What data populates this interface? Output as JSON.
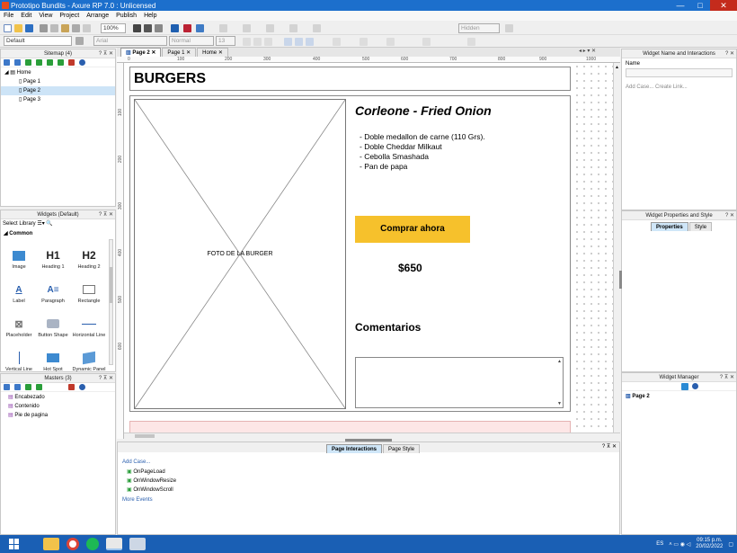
{
  "titlebar": {
    "title": "Prototipo Bundits - Axure RP 7.0 : Unlicensed",
    "min": "—",
    "max": "□",
    "close": "✕"
  },
  "menu": [
    "File",
    "Edit",
    "View",
    "Project",
    "Arrange",
    "Publish",
    "Help"
  ],
  "toolbar": {
    "zoom": "100%",
    "style": "Default",
    "font": "Arial",
    "weight": "Normal",
    "size": "13",
    "hidden_label": "Hidden"
  },
  "sitemap": {
    "title": "Sitemap (4)",
    "items": [
      "Home",
      "Page 1",
      "Page 2",
      "Page 3"
    ]
  },
  "widgets": {
    "title": "Widgets (Default)",
    "select_label": "Select Library",
    "section": "Common",
    "items": [
      {
        "label": "Image",
        "icon": "image-icon"
      },
      {
        "label": "Heading 1",
        "icon": "H1"
      },
      {
        "label": "Heading 2",
        "icon": "H2"
      },
      {
        "label": "Label",
        "icon": "A_"
      },
      {
        "label": "Paragraph",
        "icon": "A≡"
      },
      {
        "label": "Rectangle",
        "icon": "rect-icon"
      },
      {
        "label": "Placeholder",
        "icon": "placeholder-icon"
      },
      {
        "label": "Button Shape",
        "icon": "button-shape-icon"
      },
      {
        "label": "Horizontal Line",
        "icon": "hline-icon"
      },
      {
        "label": "Vertical Line",
        "icon": "vline-icon"
      },
      {
        "label": "Hot Spot",
        "icon": "hotspot-icon"
      },
      {
        "label": "Dynamic Panel",
        "icon": "dynamic-panel-icon"
      }
    ]
  },
  "masters": {
    "title": "Masters (3)",
    "items": [
      "Encabezado",
      "Contenido",
      "Pie de pagina"
    ]
  },
  "tabs": [
    "Page 2",
    "Page 1",
    "Home"
  ],
  "ruler_h": [
    "0",
    "100",
    "200",
    "300",
    "400",
    "500",
    "600",
    "700",
    "800",
    "900",
    "1000"
  ],
  "ruler_v": [
    "100",
    "200",
    "300",
    "400",
    "500",
    "600"
  ],
  "page": {
    "header": "BURGERS",
    "image_label": "FOTO DE LA BURGER",
    "product_title": "Corleone - Fried Onion",
    "ingredients": [
      "- Doble medallon de carne (110 Grs).",
      "- Doble Cheddar Milkaut",
      "- Cebolla Smashada",
      "- Pan de papa"
    ],
    "buy_button": "Comprar ahora",
    "price": "$650",
    "comments_heading": "Comentarios",
    "accent": "#f6c12c"
  },
  "bottom": {
    "tab_interactions": "Page Interactions",
    "tab_style": "Page Style",
    "add_case": "Add Case...",
    "events": [
      "OnPageLoad",
      "OnWindowResize",
      "OnWindowScroll"
    ],
    "more": "More Events"
  },
  "right": {
    "name_title": "Widget Name and Interactions",
    "name_label": "Name",
    "add_case": "Add Case...",
    "create_link": "Create Link...",
    "props_title": "Widget Properties and Style",
    "props_tab": "Properties",
    "style_tab": "Style",
    "manager_title": "Widget Manager",
    "manager_item": "Page 2"
  },
  "taskbar": {
    "lang": "ES",
    "time": "09:15 p.m.",
    "date": "20/02/2022"
  }
}
